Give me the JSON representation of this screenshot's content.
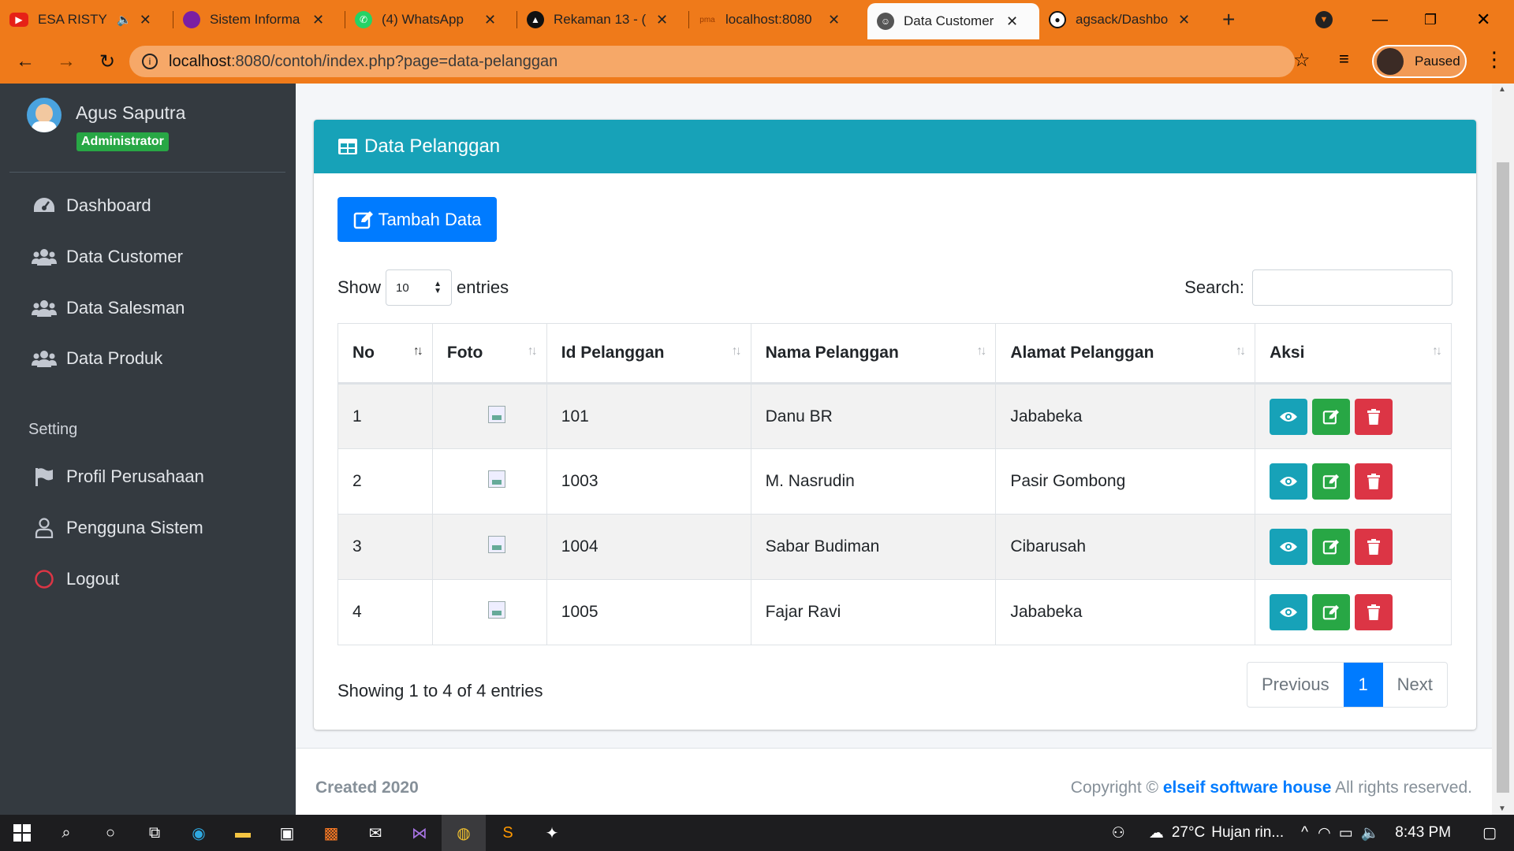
{
  "browser": {
    "tabs": [
      {
        "label": "ESA RISTY",
        "icon": "youtube-icon",
        "color": "#e62117"
      },
      {
        "label": "Sistem Informa",
        "icon": "site-icon",
        "color": "#7b1fa2"
      },
      {
        "label": "(4) WhatsApp",
        "icon": "whatsapp-icon",
        "color": "#25d366"
      },
      {
        "label": "Rekaman 13 - (",
        "icon": "triangle-icon",
        "color": "#111111"
      },
      {
        "label": "localhost:8080",
        "icon": "pma-icon",
        "color": "#f29111"
      },
      {
        "label": "Data Customer",
        "icon": "group-icon",
        "color": "#555555"
      },
      {
        "label": "agsack/Dashbo",
        "icon": "github-icon",
        "color": "#111111"
      }
    ],
    "url_host": "localhost",
    "url_path": ":8080/contoh/index.php?page=data-pelanggan",
    "profile_status": "Paused"
  },
  "sidebar": {
    "user_name": "Agus Saputra",
    "role": "Administrator",
    "menu": [
      {
        "label": "Dashboard",
        "icon": "dashboard-icon"
      },
      {
        "label": "Data Customer",
        "icon": "users-icon"
      },
      {
        "label": "Data Salesman",
        "icon": "users-icon"
      },
      {
        "label": "Data Produk",
        "icon": "users-icon"
      }
    ],
    "setting_header": "Setting",
    "setting_menu": [
      {
        "label": "Profil Perusahaan",
        "icon": "flag-icon"
      },
      {
        "label": "Pengguna Sistem",
        "icon": "user-icon"
      },
      {
        "label": "Logout",
        "icon": "logout-circle-icon"
      }
    ]
  },
  "card": {
    "title": "Data Pelanggan",
    "add_button": "Tambah Data",
    "show_label": "Show",
    "entries_value": "10",
    "entries_label": "entries",
    "search_label": "Search:",
    "columns": [
      "No",
      "Foto",
      "Id Pelanggan",
      "Nama Pelanggan",
      "Alamat Pelanggan",
      "Aksi"
    ],
    "rows": [
      {
        "no": "1",
        "id": "101",
        "nama": "Danu BR",
        "alamat": "Jababeka"
      },
      {
        "no": "2",
        "id": "1003",
        "nama": "M. Nasrudin",
        "alamat": "Pasir Gombong"
      },
      {
        "no": "3",
        "id": "1004",
        "nama": "Sabar Budiman",
        "alamat": "Cibarusah"
      },
      {
        "no": "4",
        "id": "1005",
        "nama": "Fajar Ravi",
        "alamat": "Jababeka"
      }
    ],
    "info": "Showing 1 to 4 of 4 entries",
    "pager": {
      "previous": "Previous",
      "current": "1",
      "next": "Next"
    }
  },
  "footer": {
    "created": "Created 2020",
    "copyright_prefix": "Copyright ©",
    "company": "elseif software house",
    "rights": "All rights reserved."
  },
  "taskbar": {
    "temperature": "27°C",
    "weather": "Hujan rin...",
    "time": "8:43 PM"
  },
  "colors": {
    "tab_bar": "#ef7a1a",
    "sidebar": "#343a40",
    "card_header": "#17a2b8",
    "primary": "#007bff",
    "success": "#28a745",
    "danger": "#dc3545"
  }
}
